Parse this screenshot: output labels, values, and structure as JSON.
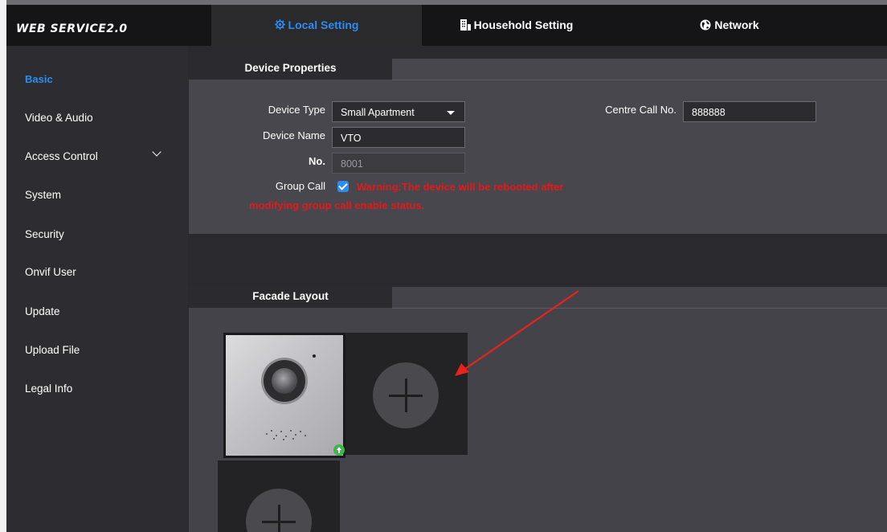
{
  "app": {
    "logo": "WEB SERVICE2.0"
  },
  "nav": {
    "tabs": [
      {
        "label": "Local Setting",
        "icon": "gear-icon",
        "active": true
      },
      {
        "label": "Household Setting",
        "icon": "building-icon",
        "active": false
      },
      {
        "label": "Network",
        "icon": "globe-icon",
        "active": false
      }
    ]
  },
  "sidebar": {
    "items": [
      {
        "label": "Basic",
        "active": true
      },
      {
        "label": "Video & Audio"
      },
      {
        "label": "Access Control",
        "expandable": true
      },
      {
        "label": "System"
      },
      {
        "label": "Security"
      },
      {
        "label": "Onvif User"
      },
      {
        "label": "Update"
      },
      {
        "label": "Upload File"
      },
      {
        "label": "Legal Info"
      }
    ]
  },
  "device_properties": {
    "tab_label": "Device Properties",
    "device_type": {
      "label": "Device Type",
      "value": "Small Apartment"
    },
    "device_name": {
      "label": "Device Name",
      "value": "VTO"
    },
    "number": {
      "label": "No.",
      "value": "8001"
    },
    "group_call": {
      "label": "Group Call",
      "checked": true,
      "warning_line1": "Warning:The device will be rebooted after",
      "warning_line2": "modifying group call enable status."
    },
    "centre_call": {
      "label": "Centre Call No.",
      "value": "888888"
    }
  },
  "facade_layout": {
    "tab_label": "Facade Layout",
    "cells": [
      {
        "type": "device-image",
        "icon": "upload-icon"
      },
      {
        "type": "add",
        "icon": "plus-icon"
      },
      {
        "type": "add",
        "icon": "plus-icon"
      }
    ]
  },
  "colors": {
    "accent": "#2d8cf0",
    "warning": "#e4191a",
    "annotation_arrow": "#e8231d",
    "badge": "#3db64a"
  }
}
